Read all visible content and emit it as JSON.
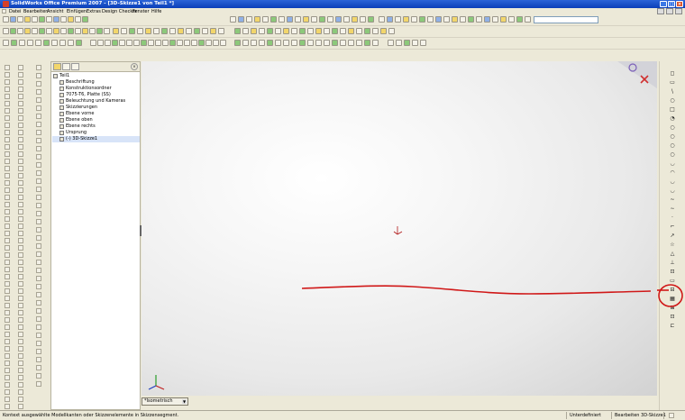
{
  "window": {
    "title": "SolidWorks Office Premium 2007 - [3D-Skizze1 von Teil1 *]",
    "buttons": [
      "_",
      "□",
      "×"
    ]
  },
  "menu": {
    "items": [
      "Datei",
      "Bearbeiten",
      "Ansicht",
      "Einfügen",
      "Extras",
      "Design Checker",
      "Fenster",
      "Hilfe"
    ]
  },
  "feature_manager": {
    "tree": [
      {
        "label": "Teil1",
        "icon": "part-icon",
        "level": 0
      },
      {
        "label": "Beschriftung",
        "icon": "annotation-icon",
        "level": 1
      },
      {
        "label": "Konstruktionsordner",
        "icon": "folder-icon",
        "level": 1
      },
      {
        "label": "7075-T6, Platte (SS)",
        "icon": "material-icon",
        "level": 1
      },
      {
        "label": "Beleuchtung und Kameras",
        "icon": "lights-icon",
        "level": 1
      },
      {
        "label": "Skizzierungen",
        "icon": "sketch-folder-icon",
        "level": 1
      },
      {
        "label": "Ebene vorne",
        "icon": "plane-icon",
        "level": 1
      },
      {
        "label": "Ebene oben",
        "icon": "plane-icon",
        "level": 1
      },
      {
        "label": "Ebene rechts",
        "icon": "plane-icon",
        "level": 1
      },
      {
        "label": "Ursprung",
        "icon": "origin-icon",
        "level": 1
      },
      {
        "label": "(-) 3D-Skizze1",
        "icon": "sketch3d-icon",
        "level": 1
      }
    ]
  },
  "view": {
    "orientation_label": "*Isometrisch"
  },
  "status": {
    "hint": "Kontext ausgewählte Modellkanten oder Skizzenelemente in Skizzensegment.",
    "state": "Unterdefiniert",
    "editing": "Bearbeiten 3D-Skizze1"
  },
  "colors": {
    "annotation_red": "#d01818",
    "title_blue": "#0a3fb8"
  }
}
